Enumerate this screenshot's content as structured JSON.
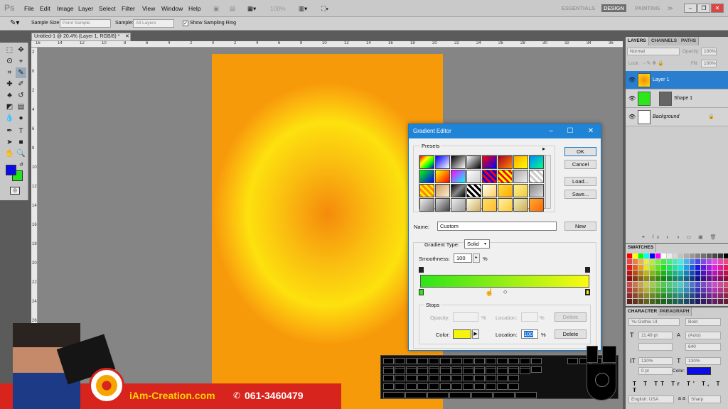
{
  "menubar": {
    "app_logo": "Ps",
    "items": [
      "File",
      "Edit",
      "Image",
      "Layer",
      "Select",
      "Filter",
      "View",
      "Window",
      "Help"
    ],
    "zoom": "100%",
    "workspaces": [
      "ESSENTIALS",
      "DESIGN",
      "PAINTING"
    ],
    "active_workspace": "DESIGN",
    "more": "≫"
  },
  "options": {
    "sample_size_label": "Sample Size:",
    "sample_size_value": "Point Sample",
    "sample_label": "Sample:",
    "sample_value": "All Layers",
    "show_ring_label": "Show Sampling Ring",
    "show_ring_checked": true
  },
  "document": {
    "tab": "Untitled-1 @ 20.4% (Layer 1, RGB/8) *",
    "ruler_top": [
      "16",
      "14",
      "12",
      "10",
      "8",
      "6",
      "4",
      "2",
      "0",
      "2",
      "4",
      "6",
      "8",
      "10",
      "12",
      "14",
      "16",
      "18",
      "20",
      "22",
      "24",
      "26",
      "28",
      "30",
      "32",
      "34",
      "36",
      "38"
    ],
    "ruler_left": [
      "2",
      "0",
      "2",
      "4",
      "6",
      "8",
      "10",
      "12",
      "14",
      "16",
      "18",
      "20",
      "22",
      "24",
      "26",
      "28",
      "30",
      "32",
      "34"
    ]
  },
  "colors": {
    "foreground": "#0b0be8",
    "background": "#22e61b"
  },
  "layers_panel": {
    "tabs": [
      "LAYERS",
      "CHANNELS",
      "PATHS"
    ],
    "blend": "Normal",
    "opacity_label": "Opacity:",
    "opacity": "100%",
    "lock_label": "Lock:",
    "fill_label": "Fill:",
    "fill": "100%",
    "layers": [
      {
        "name": "Layer 1",
        "selected": true
      },
      {
        "name": "Shape 1",
        "selected": false
      },
      {
        "name": "Background",
        "selected": false
      }
    ]
  },
  "swatches_panel": {
    "tab": "SWATCHES"
  },
  "character_panel": {
    "tabs": [
      "CHARACTER",
      "PARAGRAPH"
    ],
    "font": "Yu Gothic UI",
    "style": "Bold",
    "size": "11.49 pt",
    "leading": "(Auto)",
    "tracking": "640",
    "vscale": "130%",
    "hscale": "130%",
    "baseline": "0 pt",
    "color_label": "Color:",
    "color": "#0b0be8",
    "language": "English: USA",
    "aa_label": "a a",
    "antialias": "Sharp"
  },
  "gradient_editor": {
    "title": "Gradient Editor",
    "presets_label": "Presets",
    "ok": "OK",
    "cancel": "Cancel",
    "load": "Load...",
    "save": "Save...",
    "name_label": "Name:",
    "name_value": "Custom",
    "new": "New",
    "type_label": "Gradient Type:",
    "type_value": "Solid",
    "smooth_label": "Smoothness:",
    "smooth_value": "100",
    "smooth_unit": "%",
    "gradient_start": "#2fe419",
    "gradient_end": "#fafa12",
    "stops_label": "Stops",
    "opacity_label": "Opacity:",
    "opacity_unit": "%",
    "location_label": "Location:",
    "location_unit": "%",
    "delete": "Delete",
    "color_label": "Color:",
    "stop_color": "#f7f40c",
    "location_value": "100"
  },
  "banner": {
    "site": "iAm-Creation.com",
    "phone": "061-3460479"
  }
}
